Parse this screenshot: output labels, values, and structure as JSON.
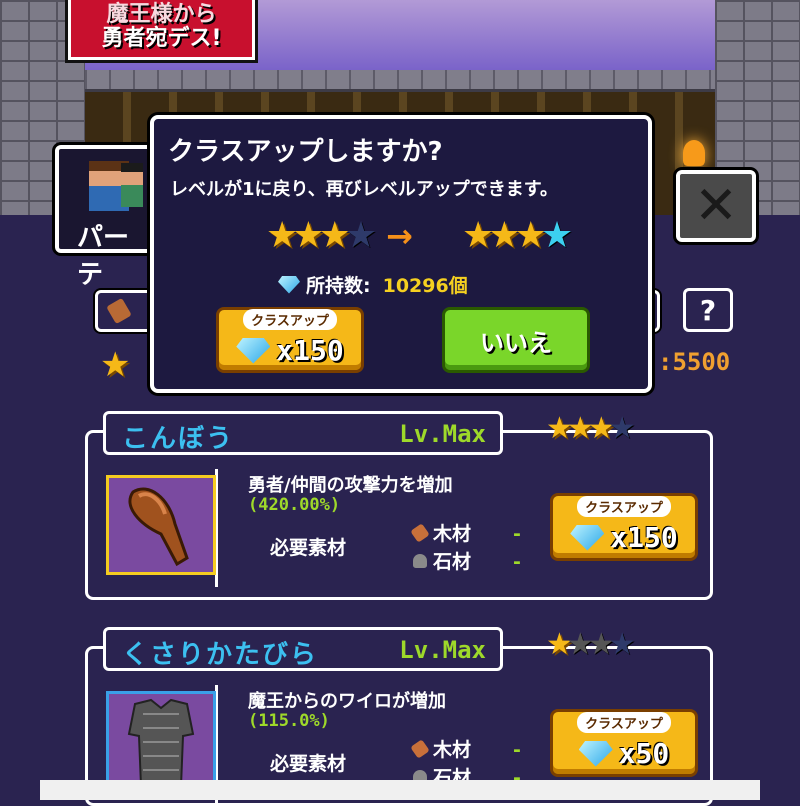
{
  "banner": {
    "line1": "魔王様から",
    "line2": "勇者宛デス!"
  },
  "party_tab": {
    "label": "パーテ"
  },
  "close_button": {
    "icon": "close-icon"
  },
  "dialog": {
    "title": "クラスアップしますか?",
    "message": "レベルが1に戻り、再びレベルアップできます。",
    "stars_before": {
      "filled": 3,
      "total": 4
    },
    "arrow": "→",
    "stars_after": {
      "filled": 3,
      "total": 4,
      "bonus_color": "#3cd0f0"
    },
    "owned_label": "所持数:",
    "owned_value": "10296個",
    "classup_button": {
      "label": "クラスアップ",
      "cost": "x150"
    },
    "no_button": {
      "label": "いいえ"
    }
  },
  "top_panel": {
    "help_label": "?",
    "currency_value": ":5500"
  },
  "items": [
    {
      "name": "こんぼう",
      "level": "Lv.Max",
      "stars_filled": 3,
      "stars_total": 4,
      "description": "勇者/仲間の攻撃力を増加",
      "bonus": "(420.00%)",
      "materials_label": "必要素材",
      "materials": [
        {
          "name": "木材",
          "amount": "-",
          "icon": "wood-icon"
        },
        {
          "name": "石材",
          "amount": "-",
          "icon": "stone-icon"
        }
      ],
      "button": {
        "label": "クラスアップ",
        "cost": "x150"
      }
    },
    {
      "name": "くさりかたびら",
      "level": "Lv.Max",
      "stars_filled": 1,
      "stars_total": 4,
      "description": "魔王からのワイロが増加",
      "bonus": "(115.0%)",
      "materials_label": "必要素材",
      "materials": [
        {
          "name": "木材",
          "amount": "-",
          "icon": "wood-icon"
        },
        {
          "name": "石材",
          "amount": "-",
          "icon": "stone-icon"
        }
      ],
      "button": {
        "label": "クラスアップ",
        "cost": "x50"
      }
    }
  ]
}
